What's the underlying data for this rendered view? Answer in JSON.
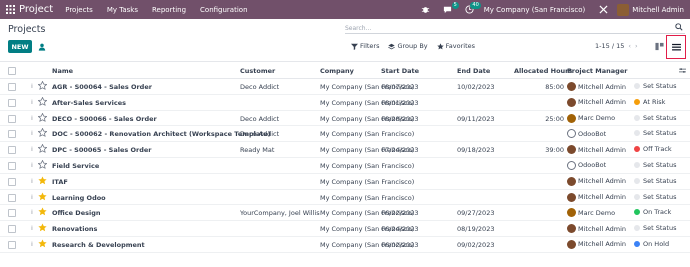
{
  "navbar": {
    "app_name": "Project",
    "menu": [
      "Projects",
      "My Tasks",
      "Reporting",
      "Configuration"
    ],
    "chat_badge": "5",
    "activity_badge": "40",
    "company": "My Company (San Francisco)",
    "user": "Mitchell Admin",
    "bg_color": "#71506a"
  },
  "control": {
    "title": "Projects",
    "search_placeholder": "Search...",
    "new_label": "NEW",
    "filters_label": "Filters",
    "groupby_label": "Group By",
    "favorites_label": "Favorites",
    "pager": "1-15 / 15"
  },
  "columns": {
    "name": "Name",
    "customer": "Customer",
    "company": "Company",
    "start": "Start Date",
    "end": "End Date",
    "hours": "Allocated Hours",
    "pm": "Project Manager"
  },
  "rows": [
    {
      "name": "AGR - S00064 - Sales Order",
      "customer": "Deco Addict",
      "company": "My Company (San Francisco)",
      "start": "08/07/2023",
      "end": "10/02/2023",
      "hours": "85:00",
      "pm": "Mitchell Admin",
      "status": "Set Status",
      "status_color": "#e5e7eb",
      "fav": false,
      "pm_type": "mitchell"
    },
    {
      "name": "After-Sales Services",
      "customer": "",
      "company": "My Company (San Francisco)",
      "start": "08/01/2023",
      "end": "",
      "hours": "",
      "pm": "Mitchell Admin",
      "status": "At Risk",
      "status_color": "#f59e0b",
      "fav": false,
      "pm_type": "mitchell"
    },
    {
      "name": "DECO - S00066 - Sales Order",
      "customer": "Deco Addict",
      "company": "My Company (San Francisco)",
      "start": "08/28/2023",
      "end": "09/11/2023",
      "hours": "25:00",
      "pm": "Marc Demo",
      "status": "Set Status",
      "status_color": "#e5e7eb",
      "fav": false,
      "pm_type": "marc"
    },
    {
      "name": "DOC - S00062 - Renovation Architect (Workspace Template)",
      "customer": "Deco Addict",
      "company": "My Company (San Francisco)",
      "start": "",
      "end": "",
      "hours": "",
      "pm": "OdooBot",
      "status": "Set Status",
      "status_color": "#e5e7eb",
      "fav": false,
      "pm_type": "bot"
    },
    {
      "name": "DPC - S00065 - Sales Order",
      "customer": "Ready Mat",
      "company": "My Company (San Francisco)",
      "start": "07/24/2023",
      "end": "09/18/2023",
      "hours": "39:00",
      "pm": "Mitchell Admin",
      "status": "Off Track",
      "status_color": "#ef4444",
      "fav": false,
      "pm_type": "mitchell"
    },
    {
      "name": "Field Service",
      "customer": "",
      "company": "My Company (San Francisco)",
      "start": "",
      "end": "",
      "hours": "",
      "pm": "OdooBot",
      "status": "Set Status",
      "status_color": "#e5e7eb",
      "fav": false,
      "pm_type": "bot"
    },
    {
      "name": "ITAF",
      "customer": "",
      "company": "My Company (San Francisco)",
      "start": "",
      "end": "",
      "hours": "",
      "pm": "Mitchell Admin",
      "status": "Set Status",
      "status_color": "#e5e7eb",
      "fav": true,
      "pm_type": "mitchell"
    },
    {
      "name": "Learning Odoo",
      "customer": "",
      "company": "My Company (San Francisco)",
      "start": "",
      "end": "",
      "hours": "",
      "pm": "Mitchell Admin",
      "status": "Set Status",
      "status_color": "#e5e7eb",
      "fav": true,
      "pm_type": "mitchell"
    },
    {
      "name": "Office Design",
      "customer": "YourCompany, Joel Willis",
      "company": "My Company (San Francisco)",
      "start": "06/22/2023",
      "end": "09/27/2023",
      "hours": "",
      "pm": "Marc Demo",
      "status": "On Track",
      "status_color": "#22c55e",
      "fav": true,
      "pm_type": "marc"
    },
    {
      "name": "Renovations",
      "customer": "",
      "company": "My Company (San Francisco)",
      "start": "06/24/2023",
      "end": "08/19/2023",
      "hours": "",
      "pm": "Mitchell Admin",
      "status": "Set Status",
      "status_color": "#e5e7eb",
      "fav": true,
      "pm_type": "mitchell"
    },
    {
      "name": "Research & Development",
      "customer": "",
      "company": "My Company (San Francisco)",
      "start": "06/02/2023",
      "end": "09/02/2023",
      "hours": "",
      "pm": "Mitchell Admin",
      "status": "On Hold",
      "status_color": "#3b82f6",
      "fav": true,
      "pm_type": "mitchell"
    }
  ],
  "colors": {
    "accent": "#017e84",
    "star": "#f3b80b",
    "highlight_box": "#e11d48"
  }
}
